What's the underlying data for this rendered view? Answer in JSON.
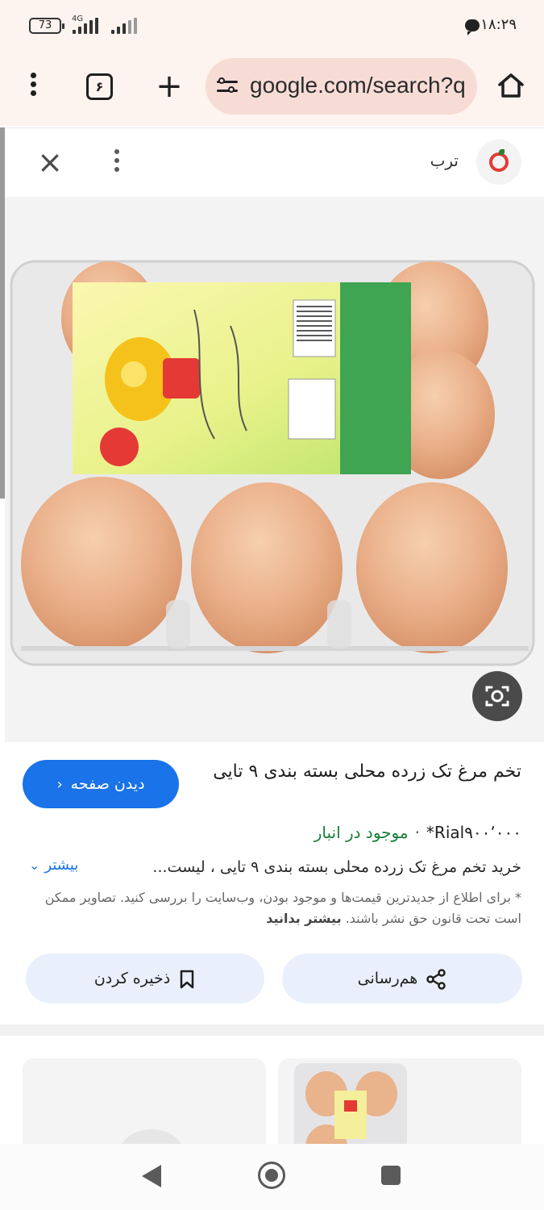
{
  "status_bar": {
    "battery": "73",
    "network": "4G",
    "time": "۱۸:۲۹"
  },
  "browser": {
    "tab_count": "۶",
    "url": "google.com/search?q"
  },
  "sheet": {
    "source_name": "ترب"
  },
  "result": {
    "title": "تخم مرغ تک زرده محلی بسته بندی ۹ تایی",
    "visit_label": "دیدن صفحه",
    "price": "Rial۹۰۰٬۰۰۰*",
    "stock": "موجود در انبار",
    "description": "خرید تخم مرغ تک زرده محلی بسته بندی ۹ تایی ، لیست...",
    "more_label": "بیشتر",
    "disclaimer": "* برای اطلاع از جدیدترین قیمت‌ها و موجود بودن، وب‌سایت را بررسی کنید. تصاویر ممکن است تحت قانون حق نشر باشند.",
    "learn_more": "بیشتر بدانید"
  },
  "actions": {
    "share_label": "هم‌رسانی",
    "save_label": "ذخیره کردن"
  },
  "colors": {
    "accent": "#1a73e8",
    "in_stock": "#188038",
    "toolbar_bg": "#fdf3ef",
    "urlbar_bg": "#f7dcd6",
    "action_bg": "#eaf0fb"
  },
  "icons": {
    "browser_menu": "more-vert-icon",
    "tabs": "tab-switcher-icon",
    "new_tab": "plus-icon",
    "site_settings": "tune-icon",
    "home": "home-icon",
    "close": "close-icon",
    "sheet_menu": "more-vert-icon",
    "lens": "lens-icon",
    "share": "share-icon",
    "save": "bookmark-icon"
  }
}
